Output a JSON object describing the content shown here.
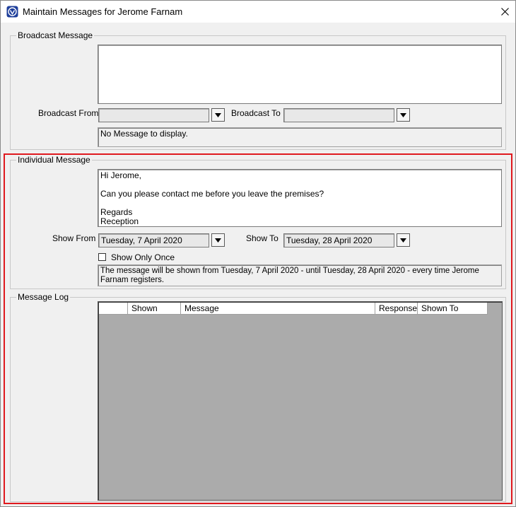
{
  "window": {
    "title": "Maintain Messages for Jerome Farnam",
    "icon": "app-logo-icon",
    "close_icon": "close-icon"
  },
  "broadcast": {
    "group_label": "Broadcast Message",
    "message_text": "",
    "from_label": "Broadcast From",
    "from_value": "",
    "to_label": "Broadcast To",
    "to_value": "",
    "info_text": "No Message to display."
  },
  "individual": {
    "group_label": "Individual Message",
    "message_text": "Hi Jerome,\n\nCan you please contact me before you leave the premises?\n\nRegards\nReception",
    "show_from_label": "Show From",
    "show_from_value": "Tuesday, 7 April 2020",
    "show_to_label": "Show To",
    "show_to_value": "Tuesday, 28 April 2020",
    "show_once_label": "Show Only Once",
    "show_once_checked": false,
    "info_text": "The message will be shown from Tuesday, 7 April 2020 - until Tuesday, 28 April 2020 - every time Jerome Farnam registers."
  },
  "log": {
    "group_label": "Message Log",
    "columns": [
      "",
      "Shown",
      "Message",
      "Response",
      "Shown To"
    ],
    "rows": []
  },
  "colors": {
    "highlight": "#e0191e",
    "grid_background": "#ababab"
  }
}
